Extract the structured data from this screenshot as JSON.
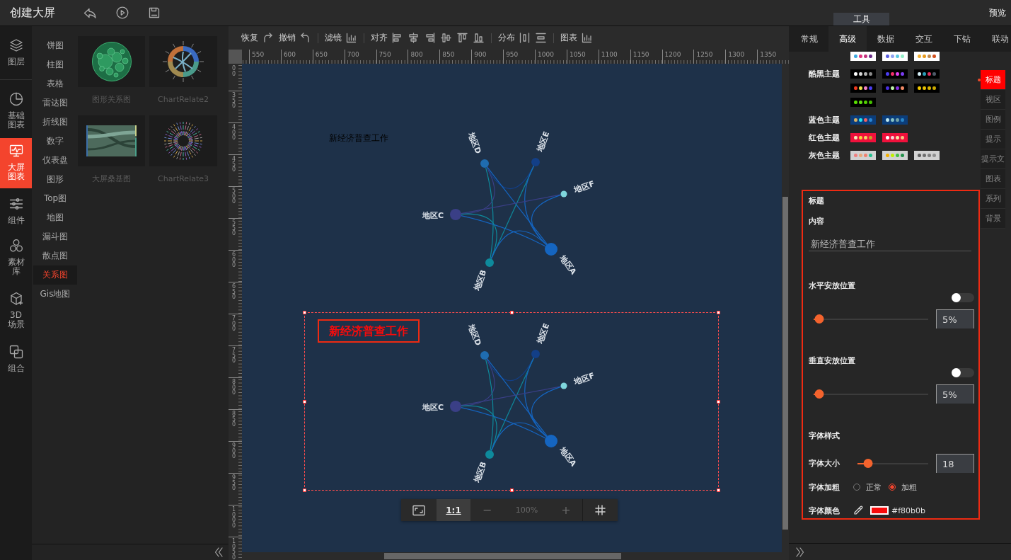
{
  "topbar": {
    "title": "创建大屏",
    "tool_tab": "工具",
    "preview": "预览"
  },
  "left_nav": [
    {
      "label": "图层",
      "selected": false
    },
    {
      "label": "基础图表",
      "selected": false
    },
    {
      "label": "大屏图表",
      "selected": true
    },
    {
      "label": "组件",
      "selected": false
    },
    {
      "label": "素材库",
      "selected": false
    },
    {
      "label": "3D场景",
      "selected": false
    },
    {
      "label": "组合",
      "selected": false
    }
  ],
  "categories": [
    {
      "label": "饼图",
      "selected": false
    },
    {
      "label": "柱图",
      "selected": false
    },
    {
      "label": "表格",
      "selected": false
    },
    {
      "label": "雷达图",
      "selected": false
    },
    {
      "label": "折线图",
      "selected": false
    },
    {
      "label": "数字",
      "selected": false
    },
    {
      "label": "仪表盘",
      "selected": false
    },
    {
      "label": "图形",
      "selected": false
    },
    {
      "label": "Top图",
      "selected": false
    },
    {
      "label": "地图",
      "selected": false
    },
    {
      "label": "漏斗图",
      "selected": false
    },
    {
      "label": "散点图",
      "selected": false
    },
    {
      "label": "关系图",
      "selected": true
    },
    {
      "label": "Gis地图",
      "selected": false
    }
  ],
  "thumbnails": [
    {
      "caption": "图形关系图"
    },
    {
      "caption": "ChartRelate2"
    },
    {
      "caption": "大屏桑基图"
    },
    {
      "caption": "ChartRelate3"
    }
  ],
  "toolbar": [
    {
      "items": [
        {
          "label": "恢复"
        },
        {
          "label": "撤销"
        }
      ]
    },
    {
      "items": [
        {
          "label": "滤镜"
        }
      ]
    },
    {
      "items": [
        {
          "label": "对齐"
        }
      ]
    },
    {
      "items": [
        {
          "label": "分布"
        }
      ]
    },
    {
      "items": [
        {
          "label": "图表"
        }
      ]
    }
  ],
  "rulers": {
    "horizontal": [
      "550",
      "600",
      "650",
      "700",
      "750",
      "800",
      "850",
      "900",
      "950",
      "1000",
      "1050",
      "1100",
      "1150",
      "1200",
      "1250",
      "1300",
      "1350"
    ],
    "vertical": [
      "00",
      "350",
      "400",
      "450",
      "500",
      "550",
      "600",
      "650",
      "700",
      "750",
      "800",
      "850",
      "900",
      "950",
      "1000",
      "1050"
    ]
  },
  "charts": [
    {
      "selected": false,
      "title": {
        "text": "新经济普查工作",
        "color": "#000000",
        "bold": false,
        "highlighted": false
      },
      "nodes": [
        {
          "label": "地区D",
          "color": "#1f6cb0"
        },
        {
          "label": "地区E",
          "color": "#133f87"
        },
        {
          "label": "地区F",
          "color": "#7fd6dc"
        },
        {
          "label": "地区C",
          "color": "#3a3f86"
        },
        {
          "label": "地区A",
          "color": "#1565c0"
        },
        {
          "label": "地区B",
          "color": "#0e8a9c"
        }
      ]
    },
    {
      "selected": true,
      "title": {
        "text": "新经济普查工作",
        "color": "#f80b0b",
        "bold": true,
        "highlighted": true
      },
      "nodes": [
        {
          "label": "地区D",
          "color": "#1f6cb0"
        },
        {
          "label": "地区E",
          "color": "#133f87"
        },
        {
          "label": "地区F",
          "color": "#7fd6dc"
        },
        {
          "label": "地区C",
          "color": "#3a3f86"
        },
        {
          "label": "地区A",
          "color": "#1565c0"
        },
        {
          "label": "地区B",
          "color": "#0e8a9c"
        }
      ]
    }
  ],
  "zoom_bar": {
    "actual_size": {
      "label": "1:1",
      "selected": true
    },
    "zoom_out": {
      "label": "−",
      "disabled": true
    },
    "zoom_level": "100%",
    "zoom_in": {
      "label": "+",
      "disabled": true
    }
  },
  "right_panel": {
    "tabs": [
      {
        "label": "常规",
        "selected": false
      },
      {
        "label": "高级",
        "selected": true
      },
      {
        "label": "数据",
        "selected": false
      },
      {
        "label": "交互",
        "selected": false
      },
      {
        "label": "下钻",
        "selected": false
      },
      {
        "label": "联动",
        "selected": false
      }
    ],
    "theme_groups": [
      {
        "swatches": [
          {
            "color": "#ffffff",
            "dots": [
              {
                "color": "#3fa9e0"
              },
              {
                "color": "#e0347e"
              },
              {
                "color": "#c2317e"
              },
              {
                "color": "#6a2d88"
              }
            ]
          },
          {
            "color": "#ffffff",
            "dots": [
              {
                "color": "#5a5fe0"
              },
              {
                "color": "#8fa3f2"
              },
              {
                "color": "#5ac8e0"
              },
              {
                "color": "#93f0c9"
              }
            ]
          },
          {
            "color": "#ffffff",
            "dots": [
              {
                "color": "#f2b233"
              },
              {
                "color": "#e89b1e"
              },
              {
                "color": "#c08a4e"
              },
              {
                "color": "#d2501e"
              }
            ]
          }
        ]
      },
      {
        "label": "酷黑主题",
        "swatches": [
          {
            "color": "#000000",
            "dots": [
              {
                "color": "#ffffff"
              },
              {
                "color": "#d9d9d9"
              },
              {
                "color": "#b3b3b3"
              },
              {
                "color": "#8c8c8c"
              }
            ]
          },
          {
            "color": "#000000",
            "dots": [
              {
                "color": "#4b3df2"
              },
              {
                "color": "#f2306b"
              },
              {
                "color": "#e23ff2"
              },
              {
                "color": "#7a3df2"
              }
            ]
          },
          {
            "color": "#000000",
            "dots": [
              {
                "color": "#d9f2fa"
              },
              {
                "color": "#2a9fb8"
              },
              {
                "color": "#e0305e"
              },
              {
                "color": "#4f5a68"
              }
            ]
          },
          {
            "color": "#000000",
            "dots": [
              {
                "color": "#f23a1e"
              },
              {
                "color": "#f2e24a"
              },
              {
                "color": "#f283c8"
              },
              {
                "color": "#4a3df2"
              }
            ]
          },
          {
            "color": "#000000",
            "dots": [
              {
                "color": "#4b30e0"
              },
              {
                "color": "#bff2a8"
              },
              {
                "color": "#8030e0"
              },
              {
                "color": "#f28a66"
              }
            ]
          },
          {
            "color": "#000000",
            "dots": [
              {
                "color": "#f2c800"
              },
              {
                "color": "#e6c000"
              },
              {
                "color": "#d9b400"
              },
              {
                "color": "#c9a800"
              }
            ]
          },
          {
            "color": "#000000",
            "dots": [
              {
                "color": "#5ae000"
              },
              {
                "color": "#62e010"
              },
              {
                "color": "#52d000"
              },
              {
                "color": "#44c000"
              }
            ]
          }
        ]
      },
      {
        "label": "蓝色主题",
        "swatches": [
          {
            "color": "#0b3d7a",
            "dots": [
              {
                "color": "#d9b066"
              },
              {
                "color": "#22e6f2"
              },
              {
                "color": "#f06262"
              },
              {
                "color": "#2a86d6"
              }
            ]
          },
          {
            "color": "#0b3d7a",
            "dots": [
              {
                "color": "#bde8f0"
              },
              {
                "color": "#86c2c4"
              },
              {
                "color": "#72a2a6"
              },
              {
                "color": "#2a86c6"
              }
            ]
          }
        ]
      },
      {
        "label": "红色主题",
        "swatches": [
          {
            "color": "#f0113c",
            "dots": [
              {
                "color": "#fae6b8"
              },
              {
                "color": "#f8d23c"
              },
              {
                "color": "#f2d266"
              },
              {
                "color": "#c8a024"
              }
            ]
          },
          {
            "color": "#f0113c",
            "dots": [
              {
                "color": "#ffffff"
              },
              {
                "color": "#f8d4d4"
              },
              {
                "color": "#f8e2a4"
              },
              {
                "color": "#f8c080"
              }
            ]
          }
        ]
      },
      {
        "label": "灰色主题",
        "swatches": [
          {
            "color": "#d2d2d2",
            "dots": [
              {
                "color": "#f08080"
              },
              {
                "color": "#e8aa7a"
              },
              {
                "color": "#f0806e"
              },
              {
                "color": "#22c08e"
              }
            ]
          },
          {
            "color": "#d2d2d2",
            "dots": [
              {
                "color": "#f2b000"
              },
              {
                "color": "#c2f000"
              },
              {
                "color": "#44c044"
              },
              {
                "color": "#22904a"
              }
            ]
          },
          {
            "color": "#d2d2d2",
            "dots": [
              {
                "color": "#5e5e5e"
              },
              {
                "color": "#6e6e6e"
              },
              {
                "color": "#7e7e7e"
              },
              {
                "color": "#909090"
              }
            ]
          }
        ]
      }
    ],
    "side_tabs": [
      {
        "label": "标题",
        "selected": true
      },
      {
        "label": "视区",
        "selected": false
      },
      {
        "label": "图例",
        "selected": false
      },
      {
        "label": "提示",
        "selected": false
      },
      {
        "label": "提示文",
        "selected": false
      },
      {
        "label": "图表",
        "selected": false
      },
      {
        "label": "系列",
        "selected": false
      },
      {
        "label": "背景",
        "selected": false
      }
    ],
    "title_settings": {
      "highlighted": true,
      "heading": "标题",
      "content_label": "内容",
      "content_value": "新经济普查工作",
      "horizontal": {
        "label": "水平安放位置",
        "toggle_on": false,
        "level": 0.05,
        "value": "5%"
      },
      "vertical": {
        "label": "垂直安放位置",
        "toggle_on": false,
        "level": 0.05,
        "value": "5%"
      },
      "font_heading": "字体样式",
      "font_size": {
        "label": "字体大小",
        "level": 0.15,
        "value": "18"
      },
      "font_weight": {
        "label": "字体加粗",
        "options": [
          {
            "label": "正常",
            "selected": false
          },
          {
            "label": "加粗",
            "selected": true
          }
        ]
      },
      "font_color": {
        "label": "字体颜色",
        "color": "#f80b0b",
        "value": "#f80b0b"
      }
    }
  }
}
